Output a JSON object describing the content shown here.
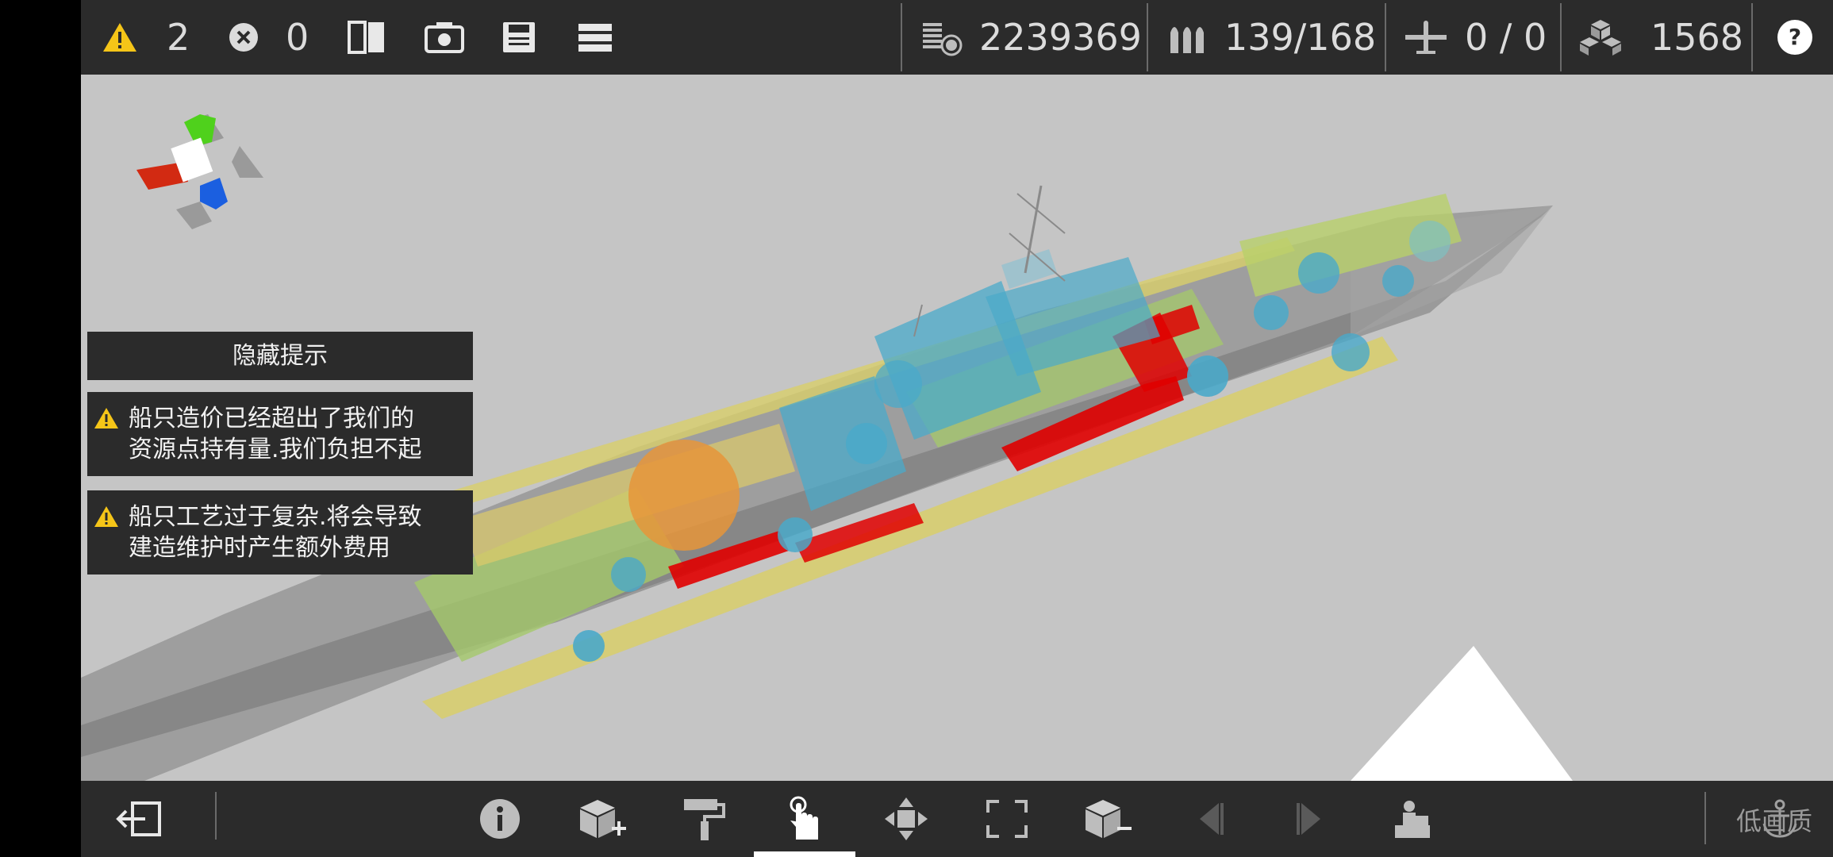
{
  "top_bar": {
    "warnings": {
      "icon": "warning-icon",
      "count": "2",
      "color": "#f5c518"
    },
    "errors": {
      "icon": "error-circle-icon",
      "count": "0"
    },
    "tools": [
      {
        "name": "mirror-view-icon"
      },
      {
        "name": "camera-icon"
      },
      {
        "name": "save-icon"
      },
      {
        "name": "menu-icon"
      }
    ],
    "stats": {
      "cost": {
        "icon": "cost-icon",
        "value": "2239369"
      },
      "ammo": {
        "icon": "ammo-icon",
        "value": "139/168"
      },
      "aircraft": {
        "icon": "aircraft-icon",
        "value": "0 / 0"
      },
      "blocks": {
        "icon": "blocks-icon",
        "value": "1568"
      }
    },
    "help": {
      "icon": "help-icon"
    }
  },
  "hints": {
    "hide_button": "隐藏提示",
    "messages": [
      {
        "line1": "船只造价已经超出了我们的",
        "line2": "资源点持有量.我们负担不起"
      },
      {
        "line1": "船只工艺过于复杂.将会导致",
        "line2": "建造维护时产生额外费用"
      }
    ]
  },
  "bottom_bar": {
    "tools": [
      {
        "name": "exit-icon"
      },
      {
        "name": "info-icon"
      },
      {
        "name": "add-block-icon"
      },
      {
        "name": "paint-roller-icon"
      },
      {
        "name": "select-hand-icon",
        "active": true
      },
      {
        "name": "move-icon"
      },
      {
        "name": "scale-icon"
      },
      {
        "name": "remove-block-icon"
      },
      {
        "name": "prev-icon"
      },
      {
        "name": "next-icon"
      },
      {
        "name": "place-turret-icon"
      },
      {
        "name": "anchor-icon"
      }
    ],
    "quality_label": "低画质"
  },
  "scene": {
    "colors": {
      "hull": "#8c8c8c",
      "deck": "#e2d36a",
      "green": "#9fcf6a",
      "blue": "#4aa9c9",
      "red": "#e00000",
      "orange": "#e6953a"
    },
    "gizmo": {
      "x": "#d22a12",
      "y": "#4fd11c",
      "z": "#1b5fe0"
    }
  }
}
